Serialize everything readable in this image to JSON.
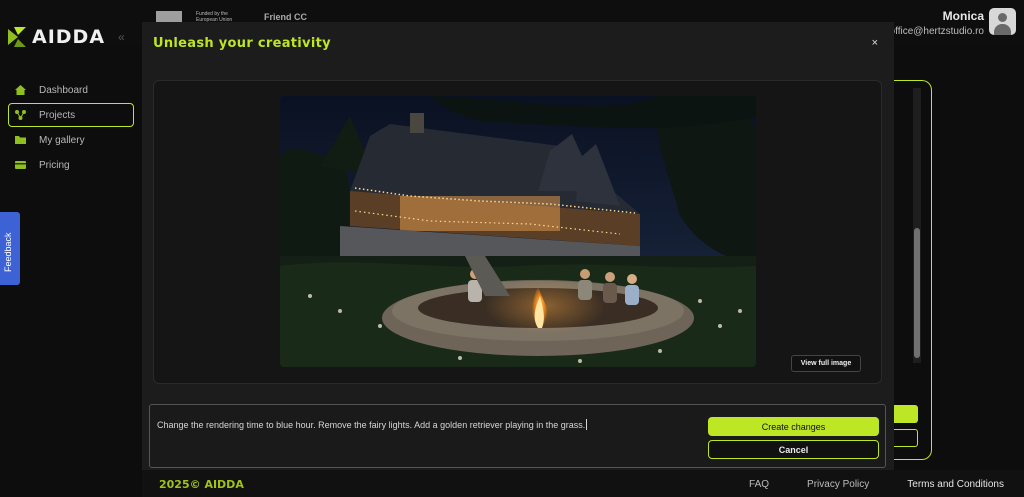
{
  "app": {
    "name": "AIDDA",
    "collapse_glyph": "«"
  },
  "funders": {
    "eu_text": "Funded by the European Union",
    "gov_text": "Friend CC"
  },
  "user": {
    "name": "Monica",
    "email": "office@hertzstudio.ro",
    "avatar_icon": "user-avatar-icon"
  },
  "sidebar": {
    "items": [
      {
        "label": "Dashboard",
        "icon": "home-icon",
        "active": false
      },
      {
        "label": "Projects",
        "icon": "nodes-icon",
        "active": true
      },
      {
        "label": "My gallery",
        "icon": "folder-icon",
        "active": false
      },
      {
        "label": "Pricing",
        "icon": "card-icon",
        "active": false
      }
    ]
  },
  "feedback": {
    "label": "Feedback"
  },
  "modal": {
    "title": "Unleash your creativity",
    "close_glyph": "×",
    "image_alt": "Night rendering of a timber lodge with fairy lights and people around a fire pit",
    "view_full_label": "View full image",
    "prompt_text": "Change the rendering time to blue hour. Remove the fairy lights. Add a golden retriever playing in the grass.",
    "create_label": "Create changes",
    "cancel_label": "Cancel"
  },
  "footer": {
    "copyright": "2025© AIDDA",
    "faq": "FAQ",
    "privacy": "Privacy Policy",
    "terms": "Terms and Conditions"
  },
  "colors": {
    "accent": "#bde624",
    "background": "#0d0d0d",
    "modal": "#1c1c1c",
    "feedback": "#3d62d6"
  }
}
